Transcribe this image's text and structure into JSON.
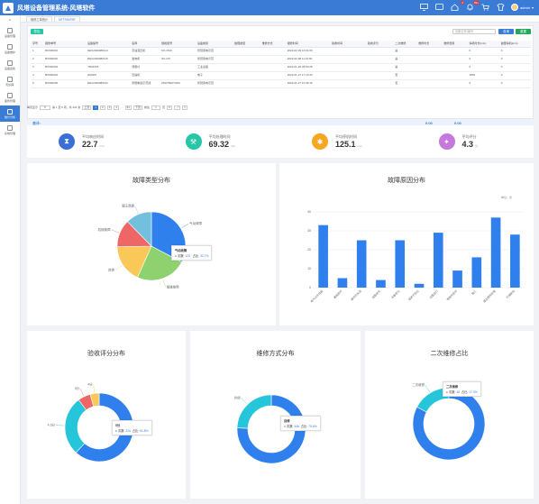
{
  "app": {
    "title": "风塔设备管理系统-风塔软件"
  },
  "header": {
    "badge_msg": "2",
    "badge_alert": "99+",
    "user": "admin"
  },
  "sidebar": {
    "items": [
      {
        "label": "设备管理"
      },
      {
        "label": "设备维护"
      },
      {
        "label": "设备巡检"
      },
      {
        "label": "知识库"
      },
      {
        "label": "备件管理"
      },
      {
        "label": "统计分析"
      },
      {
        "label": "系统管理"
      }
    ]
  },
  "tabs": [
    {
      "label": "维修工单统计"
    },
    {
      "label": "MTTR/MTBF"
    }
  ],
  "toolbar": {
    "export": "导出",
    "search_placeholder": "设备名称/编号",
    "query": "查询",
    "reset": "重置"
  },
  "table": {
    "headers": [
      "序号",
      "报修单号",
      "设备编号",
      "名称",
      "规格型号",
      "设备类别",
      "故障类型",
      "维修方式",
      "报修时间",
      "验收时间",
      "验收评分",
      "二次维修",
      "维修时长",
      "维修费用",
      "停机时长(min)",
      "故障停机(min)"
    ],
    "rows": [
      [
        "1",
        "BX000001",
        "DEV2020080114",
        "高速液压机",
        "SX-1516",
        "智慧用电示范",
        "",
        "",
        "2022-02-09 10:01:06",
        "",
        "",
        "是",
        "",
        "",
        "0",
        "0"
      ],
      [
        "2",
        "BX000002",
        "DEV2020080115",
        "发电机",
        "SX-270",
        "智慧用电示范",
        "",
        "",
        "2022-02-08 11:31:50",
        "",
        "",
        "是",
        "",
        "",
        "0",
        "0"
      ],
      [
        "3",
        "BX000003",
        "YB22018",
        "测量仪",
        "",
        "工业设备",
        "",
        "",
        "2022-01-26 09:50:28",
        "",
        "",
        "是",
        "",
        "",
        "0",
        "0"
      ],
      [
        "4",
        "BX000004",
        "200002",
        "压缩机",
        "",
        "电子",
        "",
        "",
        "2022-01-27 17:10:43",
        "",
        "",
        "否",
        "",
        "",
        "1862",
        "0"
      ],
      [
        "5",
        "BX000005",
        "DEV2020080132",
        "智能制造示范线",
        "2500*800*2000",
        "智慧用电示范",
        "",
        "",
        "2022-01-27 10:46:16",
        "",
        "",
        "否",
        "",
        "",
        "0",
        "0"
      ]
    ],
    "sum_label": "合计:",
    "sum_a": "0.00",
    "sum_b": "0.00"
  },
  "pager": {
    "size_label": "每页显示",
    "size": "5",
    "info": "第 1 至 5 项，共 401 条",
    "prev": "上页",
    "pages": [
      "1",
      "2",
      "3",
      "4",
      "...",
      "81"
    ],
    "next": "下页",
    "goto": "前往",
    "page": "1",
    "unit": "页"
  },
  "stats": [
    {
      "label": "平均响应时间",
      "value": "22.7",
      "unit": "min",
      "color": "#3a6fd6",
      "icon": "hourglass-icon"
    },
    {
      "label": "平均处理时间",
      "value": "69.32",
      "unit": "min",
      "color": "#26c6a6",
      "icon": "wrench-icon"
    },
    {
      "label": "平均停机时间",
      "value": "125.1",
      "unit": "min",
      "color": "#f5a623",
      "icon": "gear-icon"
    },
    {
      "label": "平均评分",
      "value": "4.3",
      "unit": "分",
      "color": "#c678dd",
      "icon": "star-icon"
    }
  ],
  "charts": {
    "fault_type": {
      "title": "故障类型分布",
      "tooltip_name": "气动故障",
      "tooltip_count_label": "次数",
      "tooltip_count": "123",
      "tooltip_pct_label": "占比",
      "tooltip_pct": "32.7%"
    },
    "fault_reason": {
      "title": "故障原因分布",
      "unit": "单位：次"
    },
    "acceptance": {
      "title": "验收评分分布",
      "tooltip_name": "5分",
      "tooltip_count_label": "次数",
      "tooltip_count": "224",
      "tooltip_pct_label": "占比",
      "tooltip_pct": "61.8%"
    },
    "repair_mode": {
      "title": "维修方式分布",
      "tooltip_name": "自修",
      "tooltip_count_label": "次数",
      "tooltip_count": "346",
      "tooltip_pct_label": "占比",
      "tooltip_pct": "75.6%"
    },
    "second_repair": {
      "title": "二次维修占比",
      "tooltip_name": "二次维修",
      "tooltip_count_label": "次数",
      "tooltip_count": "48",
      "tooltip_pct_label": "占比",
      "tooltip_pct": "17.3%"
    }
  },
  "chart_data": [
    {
      "type": "pie",
      "title": "故障类型分布",
      "labels": [
        "气动故障",
        "管道故障",
        "其他",
        "机械故障",
        "液压泄漏"
      ],
      "values": [
        32.7,
        24,
        18,
        13,
        12.3
      ],
      "colors": [
        "#2f80ed",
        "#8fd16e",
        "#fac858",
        "#ee6666",
        "#73c0de"
      ]
    },
    {
      "type": "bar",
      "title": "故障原因分布",
      "categories": [
        "电气元件烧毁",
        "漏电损坏",
        "操作员失误",
        "线路老化",
        "设备老化",
        "保养不到位",
        "过载运行",
        "零部件损坏",
        "施工",
        "超出使用年限",
        "环境影响"
      ],
      "values": [
        33,
        5,
        25,
        4,
        25,
        2,
        29,
        9,
        16,
        37,
        28
      ],
      "ylim": [
        0,
        40
      ],
      "yticks": [
        0,
        10,
        20,
        30,
        40
      ],
      "color": "#2f80ed"
    },
    {
      "type": "pie",
      "title": "验收评分分布",
      "labels": [
        "5分",
        "4.5分",
        "3分",
        "4分"
      ],
      "values": [
        61.8,
        28,
        6,
        4.2
      ],
      "colors": [
        "#2f80ed",
        "#26c6da",
        "#ee6666",
        "#fac858"
      ]
    },
    {
      "type": "pie",
      "title": "维修方式分布",
      "labels": [
        "自修",
        "外修"
      ],
      "values": [
        75.6,
        24.4
      ],
      "colors": [
        "#2f80ed",
        "#26c6da"
      ]
    },
    {
      "type": "pie",
      "title": "二次维修占比",
      "labels": [
        "一次维修",
        "二次维修"
      ],
      "values": [
        82.7,
        17.3
      ],
      "colors": [
        "#2f80ed",
        "#26c6da"
      ]
    }
  ]
}
